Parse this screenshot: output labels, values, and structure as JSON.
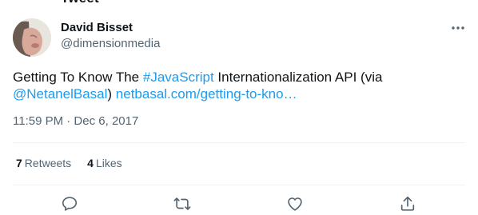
{
  "header": {
    "cut_title": "Tweet"
  },
  "author": {
    "display_name": "David Bisset",
    "handle": "@dimensionmedia",
    "avatar_icon": "user-avatar"
  },
  "tweet": {
    "text_prefix": "Getting To Know The ",
    "hashtag": "#JavaScript",
    "text_middle": " Internationalization API (via",
    "mention": "@NetanelBasal",
    "text_suffix": ") ",
    "link_text": "netbasal.com/getting-to-kno…",
    "timestamp": "11:59 PM · Dec 6, 2017"
  },
  "stats": {
    "retweets_count": "7",
    "retweets_label": "Retweets",
    "likes_count": "4",
    "likes_label": "Likes"
  },
  "actions": [
    {
      "icon": "reply-icon"
    },
    {
      "icon": "retweet-icon"
    },
    {
      "icon": "like-icon"
    },
    {
      "icon": "share-icon"
    }
  ],
  "colors": {
    "text": "#0f1419",
    "secondary": "#536471",
    "link": "#1d9bf0",
    "divider": "#eff3f4"
  }
}
